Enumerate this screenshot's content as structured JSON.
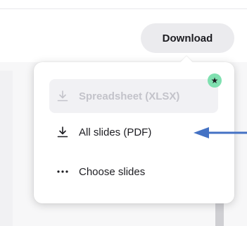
{
  "toolbar": {
    "download_label": "Download"
  },
  "download_menu": {
    "items": [
      {
        "label": "Spreadsheet (XLSX)",
        "icon": "download-icon",
        "state": "disabled",
        "badge": "★"
      },
      {
        "label": "All slides (PDF)",
        "icon": "download-icon",
        "state": "enabled"
      },
      {
        "label": "Choose slides",
        "icon": "more-dots-icon",
        "state": "enabled"
      }
    ]
  },
  "colors": {
    "annotation_arrow": "#4472c4",
    "badge": "#7fe0b0",
    "disabled_text": "#c3c3ca"
  }
}
